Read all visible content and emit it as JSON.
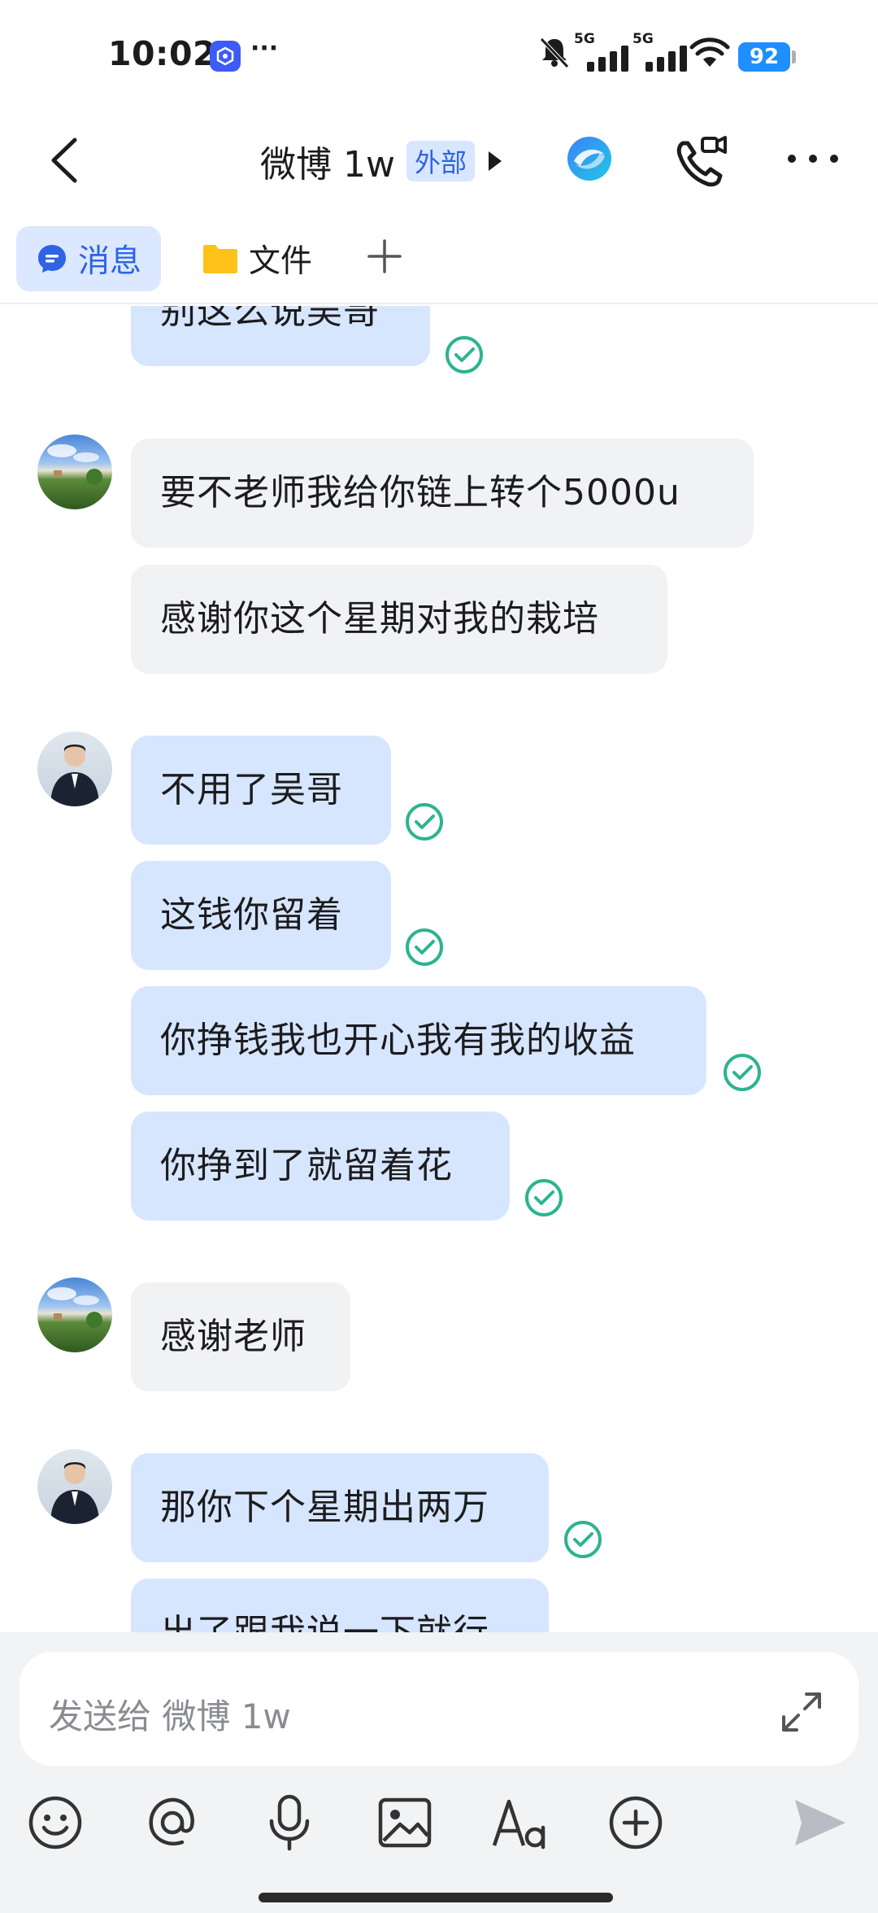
{
  "status": {
    "time": "10:02",
    "more": "···",
    "network": "5G",
    "network2": "5G",
    "battery": "92"
  },
  "header": {
    "title": "微博 1w",
    "badge": "外部"
  },
  "tabs": [
    {
      "label": "消息"
    },
    {
      "label": "文件"
    }
  ],
  "messages": [
    {
      "text": "别这么说吴哥",
      "from": "me"
    },
    {
      "text": "要不老师我给你链上转个5000u",
      "from": "other"
    },
    {
      "text": "感谢你这个星期对我的栽培",
      "from": "other"
    },
    {
      "text": "不用了吴哥",
      "from": "me"
    },
    {
      "text": "这钱你留着",
      "from": "me"
    },
    {
      "text": "你挣钱我也开心我有我的收益",
      "from": "me"
    },
    {
      "text": "你挣到了就留着花",
      "from": "me"
    },
    {
      "text": "感谢老师",
      "from": "other"
    },
    {
      "text": "那你下个星期出两万",
      "from": "me"
    },
    {
      "text": "出了跟我说一下就行",
      "from": "me"
    }
  ],
  "input": {
    "placeholder": "发送给 微博 1w"
  },
  "toolbar": {
    "icons": [
      "emoji-icon",
      "mention-icon",
      "microphone-icon",
      "image-icon",
      "text-format-icon",
      "plus-circle-icon",
      "send-icon"
    ]
  },
  "colors": {
    "accent": "#2e63e6",
    "my_bubble": "#d7e6ff",
    "other_bubble": "#f1f2f4",
    "read_check": "#2bb48f"
  }
}
